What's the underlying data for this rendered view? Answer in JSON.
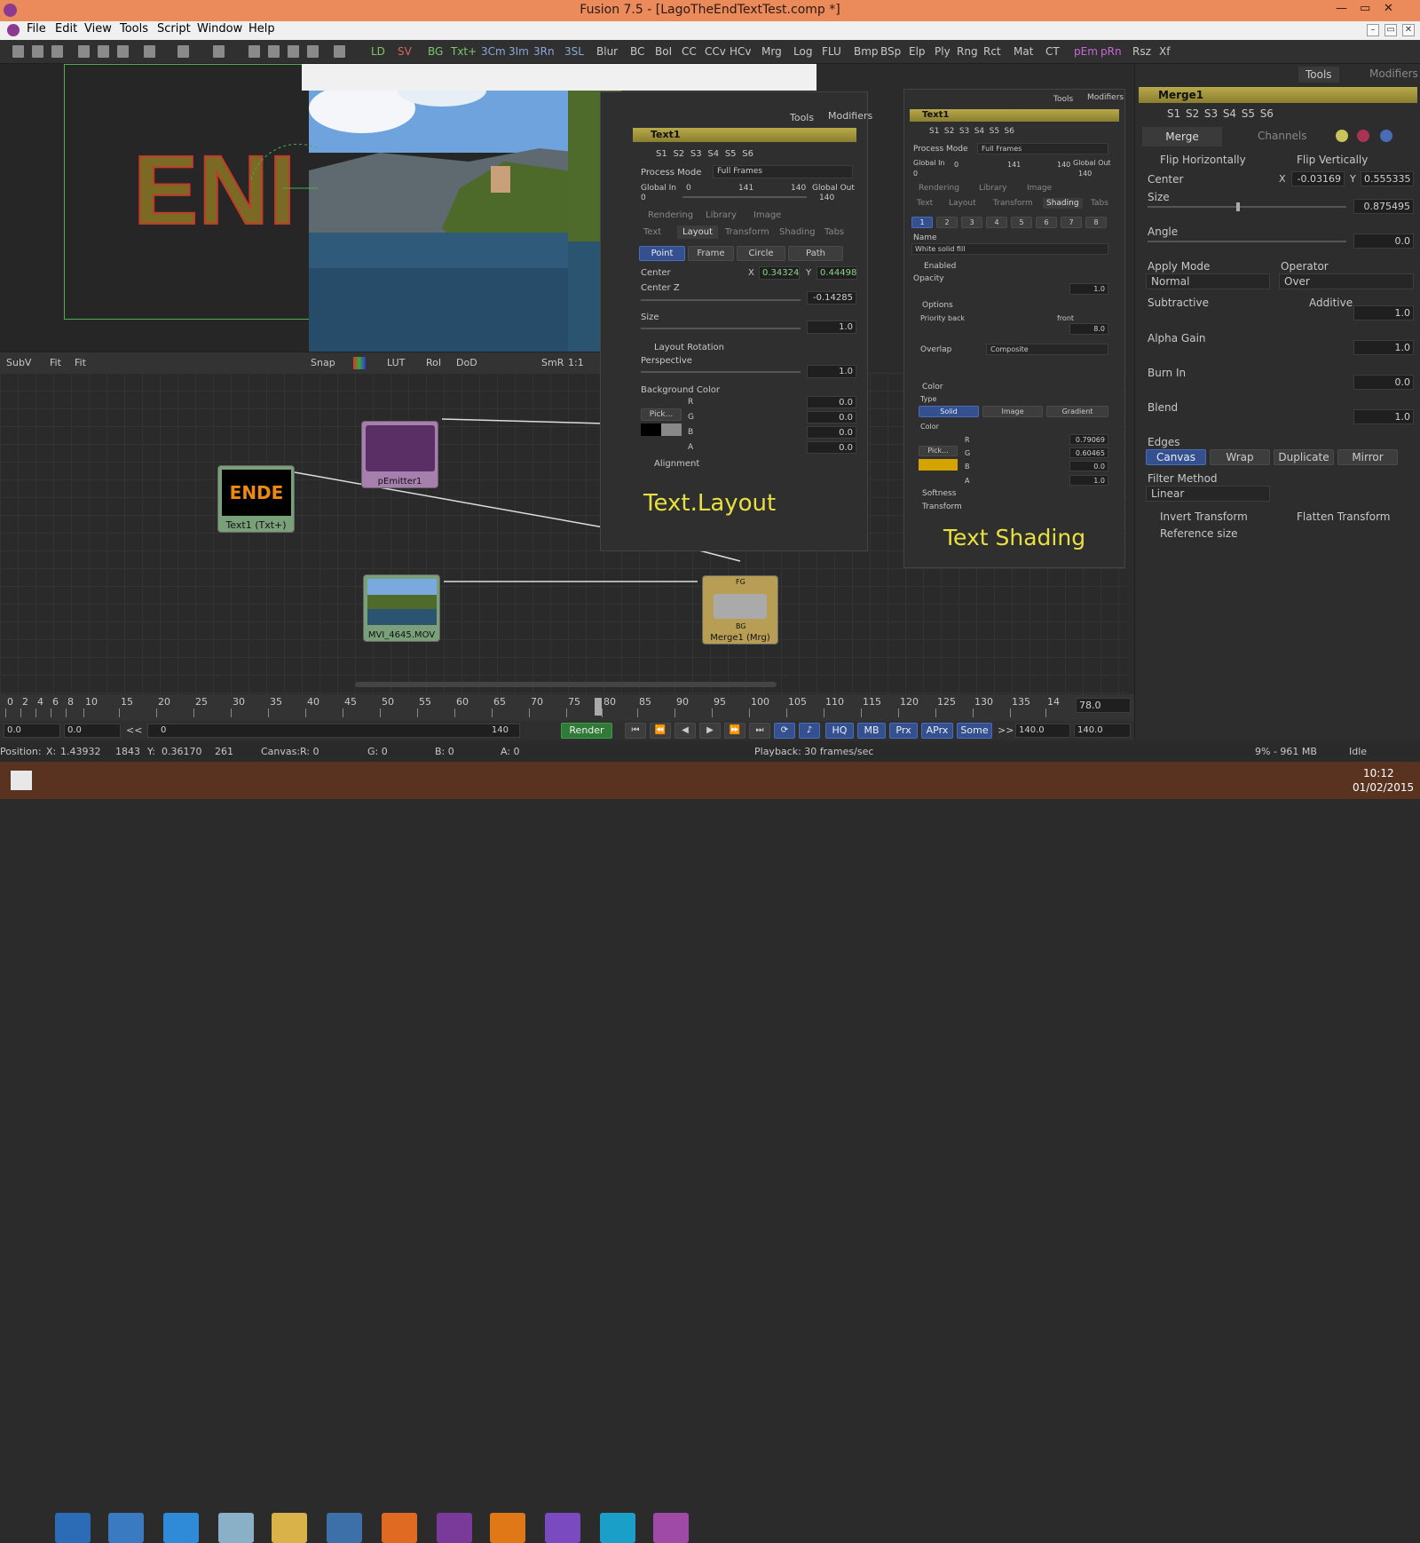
{
  "window": {
    "title": "Fusion 7.5 - [LagoTheEndTextTest.comp *]",
    "min": "—",
    "max": "▭",
    "close": "✕",
    "mdi": [
      "–",
      "▭",
      "✕"
    ]
  },
  "menu": [
    "File",
    "Edit",
    "View",
    "Tools",
    "Script",
    "Window",
    "Help"
  ],
  "toolbar": {
    "tools": [
      "LD",
      "SV",
      "BG",
      "Txt+",
      "3Cm",
      "3Im",
      "3Rn",
      "3SL",
      "Blur",
      "BC",
      "BoI",
      "CC",
      "CCv",
      "HCv",
      "Mrg",
      "Log",
      "FLU",
      "Bmp",
      "BSp",
      "Elp",
      "Ply",
      "Rng",
      "Rct",
      "Mat",
      "CT",
      "pEm",
      "pRn",
      "Rsz",
      "Xf"
    ]
  },
  "viewer": {
    "text": "ENI",
    "bar": [
      "SubV",
      "Fit",
      "Fit",
      "Snap",
      "LUT",
      "RoI",
      "DoD",
      "SmR",
      "1:1"
    ]
  },
  "text_layout": {
    "header": {
      "tabs": [
        "Tools",
        "Modifiers"
      ],
      "tool_name": "Text1",
      "versions": [
        "S1",
        "S2",
        "S3",
        "S4",
        "S5",
        "S6"
      ]
    },
    "process_mode_label": "Process Mode",
    "process_mode": "Full Frames",
    "global_in_label": "Global In",
    "global_out_label": "Global Out",
    "gin": "0",
    "gmid": "141",
    "gout": "140",
    "g_zero": "0",
    "g_out_val": "140",
    "subtabs": [
      "Rendering",
      "Library",
      "Image"
    ],
    "maintabs": [
      "Text",
      "Layout",
      "Transform",
      "Shading",
      "Tabs"
    ],
    "type_btns": [
      "Point",
      "Frame",
      "Circle",
      "Path"
    ],
    "center_label": "Center",
    "x_label": "X",
    "y_label": "Y",
    "cx": "0.34324",
    "cy": "0.44498",
    "centerz_label": "Center Z",
    "cz": "-0.14285",
    "size_label": "Size",
    "size": "1.0",
    "layout_rot": "Layout Rotation",
    "persp_label": "Perspective",
    "persp": "1.0",
    "bg_label": "Background Color",
    "r": "R",
    "g": "G",
    "b": "B",
    "a": "A",
    "bgr": "0.0",
    "bgg": "0.0",
    "bgb": "0.0",
    "bga": "0.0",
    "pick": "Pick...",
    "alignment": "Alignment",
    "caption": "Text.Layout"
  },
  "text_shading": {
    "tabs": [
      "Tools",
      "Modifiers"
    ],
    "tool_name": "Text1",
    "versions": [
      "S1",
      "S2",
      "S3",
      "S4",
      "S5",
      "S6"
    ],
    "process_mode_label": "Process Mode",
    "process_mode": "Full Frames",
    "global_in_label": "Global In",
    "global_out_label": "Global Out",
    "gin": "0",
    "gmid": "141",
    "gout": "140",
    "g_zero": "0",
    "g_out_val": "140",
    "subtabs": [
      "Rendering",
      "Library",
      "Image"
    ],
    "maintabs": [
      "Text",
      "Layout",
      "Transform",
      "Shading",
      "Tabs"
    ],
    "numbers": [
      "1",
      "2",
      "3",
      "4",
      "5",
      "6",
      "7",
      "8"
    ],
    "name_label": "Name",
    "name": "White solid fill",
    "enabled": "Enabled",
    "opacity_label": "Opacity",
    "opacity": "1.0",
    "options": "Options",
    "priority_back": "Priority back",
    "front": "front",
    "priority": "8.0",
    "overlap_label": "Overlap",
    "overlap": "Composite",
    "color_section": "Color",
    "type_label": "Type",
    "types": [
      "Solid",
      "Image",
      "Gradient"
    ],
    "color_label": "Color",
    "r": "R",
    "g": "G",
    "b": "B",
    "a": "A",
    "cr": "0.79069",
    "cg": "0.60465",
    "cb": "0.0",
    "ca": "1.0",
    "pick": "Pick...",
    "softness": "Softness",
    "transform": "Transform",
    "caption": "Text Shading",
    "swatch": "#d4a400"
  },
  "merge": {
    "tabs": [
      "Tools",
      "Modifiers"
    ],
    "tool_name": "Merge1",
    "versions": [
      "S1",
      "S2",
      "S3",
      "S4",
      "S5",
      "S6"
    ],
    "subtabs": [
      "Merge",
      "Channels"
    ],
    "flip_h": "Flip Horizontally",
    "flip_v": "Flip Vertically",
    "center_label": "Center",
    "x_label": "X",
    "y_label": "Y",
    "cx": "-0.03169",
    "cy": "0.555335",
    "size_label": "Size",
    "size": "0.875495",
    "angle_label": "Angle",
    "angle": "0.0",
    "apply_mode_label": "Apply Mode",
    "apply_mode": "Normal",
    "operator_label": "Operator",
    "operator": "Over",
    "subtractive": "Subtractive",
    "additive": "Additive",
    "sub_add": "1.0",
    "alpha_gain_label": "Alpha Gain",
    "alpha_gain": "1.0",
    "burn_in_label": "Burn In",
    "burn_in": "0.0",
    "blend_label": "Blend",
    "blend": "1.0",
    "edges_label": "Edges",
    "edges": [
      "Canvas",
      "Wrap",
      "Duplicate",
      "Mirror"
    ],
    "filter_label": "Filter Method",
    "filter": "Linear",
    "invert": "Invert Transform",
    "flatten": "Flatten Transform",
    "reference": "Reference size"
  },
  "flow": {
    "nodes": {
      "text1": "Text1 (Txt+)",
      "text1_thumb": "ENDE",
      "pemitter": "pEmitter1",
      "mvi": "MVI_4645.MOV",
      "merge": "Merge1 (Mrg)",
      "fg": "FG",
      "bg": "BG"
    }
  },
  "timeline": {
    "ticks": [
      "0",
      "2",
      "4",
      "6",
      "8",
      "10",
      "15",
      "20",
      "25",
      "30",
      "35",
      "40",
      "45",
      "50",
      "55",
      "60",
      "65",
      "70",
      "75",
      "80",
      "85",
      "90",
      "95",
      "100",
      "105",
      "110",
      "115",
      "120",
      "125",
      "130",
      "135",
      "14"
    ],
    "current": "78.0",
    "start_a": "0.0",
    "start_b": "0.0",
    "range_start": "0",
    "range_end": "140",
    "render": "Render",
    "modes": [
      "HQ",
      "MB",
      "Prx",
      "APrx",
      "Some"
    ],
    "end_a": "140.0",
    "end_b": "140.0",
    "nav": "<<",
    "nav2": ">>"
  },
  "status": {
    "position": "Position:",
    "x": "X:",
    "xv": "1.43932",
    "xp": "1843",
    "y": "Y:",
    "yv": "0.36170",
    "yp": "261",
    "canvas": "Canvas:",
    "r": "R: 0",
    "g": "G: 0",
    "b": "B: 0",
    "a": "A: 0",
    "playback": "Playback: 30 frames/sec",
    "mem": "9% - 961 MB",
    "state": "Idle"
  },
  "taskbar": {
    "time": "10:12",
    "date": "01/02/2015"
  }
}
